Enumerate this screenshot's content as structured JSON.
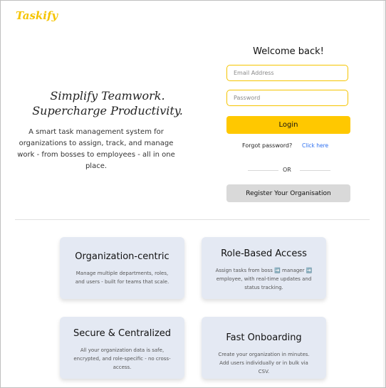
{
  "app": {
    "name": "Taskify"
  },
  "hero": {
    "title_line1": "Simplify Teamwork.",
    "title_line2": "Supercharge Productivity.",
    "description": "A smart task management system for organizations to assign, track, and manage work - from bosses to employees - all in one place."
  },
  "login": {
    "heading": "Welcome back!",
    "email_placeholder": "Email Address",
    "password_placeholder": "Password",
    "login_label": "Login",
    "forgot_text": "Forgot password?",
    "click_here_text": "Click here",
    "or_text": "OR",
    "register_label": "Register Your Organisation"
  },
  "features": [
    {
      "title": "Organization-centric",
      "description": "Manage multiple departments, roles, and users - built for teams that scale."
    },
    {
      "title": "Role-Based Access",
      "description": "Assign tasks from boss ➡️ manager ➡️ employee, with real-time updates and status tracking."
    },
    {
      "title": "Secure & Centralized",
      "description": "All your organization data is safe, encrypted, and role-specific - no cross-access."
    },
    {
      "title": "Fast Onboarding",
      "description": "Create your organization in minutes. Add users individually or in bulk via CSV."
    }
  ],
  "colors": {
    "brand": "#f5c400",
    "button_primary": "#ffc800",
    "button_secondary": "#d9d9d9",
    "link": "#2d6ff0",
    "card_bg": "#e4e9f3"
  }
}
